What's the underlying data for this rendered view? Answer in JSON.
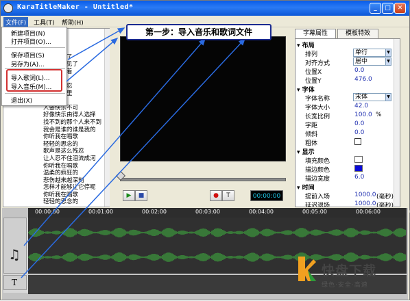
{
  "window": {
    "title": "KaraTitleMaker - Untitled*",
    "min": "_",
    "max": "□",
    "close": "✕"
  },
  "menu": {
    "file": "文件(F)",
    "tools": "工具(T)",
    "help": "帮助(H)"
  },
  "file_menu": {
    "new_project": "新建项目(N)",
    "open_project": "打开项目(O)...",
    "save_project": "保存项目(S)",
    "save_as": "另存为(A)...",
    "import_lyrics": "导入歌词(L)...",
    "import_music": "导入音乐(M)...",
    "exit": "退出(X)"
  },
  "callout": {
    "text": "第一步：导入音乐和歌词文件"
  },
  "lyrics": {
    "lines": [
      "惆怅着",
      "又开始爱了",
      "很久没再见了",
      "然也能笑着",
      "在唱歌",
      "是这么残忍",
      "在我泪眼里",
      "",
      "人要快乐不可",
      "好像快乐由得人选择",
      "找不到的那个人来不到",
      "我会是谁的谁是我的",
      "你听我在唱歌",
      "轻轻的思念的",
      "歌声是这么残忍",
      "让人忍不住泪流成河",
      "你听我在唱歌",
      "温柔的疯狂的",
      "悲伤越来越深刻",
      "怎样才能够让它停呢",
      "你听我在唱歌",
      "轻轻的思念的"
    ]
  },
  "player": {
    "play": "▶",
    "stop": "■",
    "record": "●",
    "text": "T",
    "timecode": "00:00:00"
  },
  "right_panel": {
    "tabs": {
      "subtitle": "字幕属性",
      "template": "模板特效"
    },
    "layout": {
      "section": "布局",
      "arrange_label": "排列",
      "arrange_value": "单行",
      "align_label": "对齐方式",
      "align_value": "居中",
      "pos_x_label": "位置X",
      "pos_x_value": "0.0",
      "pos_y_label": "位置Y",
      "pos_y_value": "476.0"
    },
    "font": {
      "section": "字体",
      "name_label": "字体名称",
      "name_value": "宋体",
      "size_label": "字体大小",
      "size_value": "42.0",
      "aspect_label": "长宽比例",
      "aspect_value": "100.0",
      "aspect_unit": "%",
      "spacing_label": "字距",
      "spacing_value": "0.0",
      "italic_label": "倾斜",
      "italic_value": "0.0",
      "bold_label": "粗体"
    },
    "display": {
      "section": "显示",
      "fill_label": "填充颜色",
      "fill_color": "#ffffff",
      "stroke_label": "描边颜色",
      "stroke_color": "#0a0ad8",
      "stroke_width_label": "描边宽度",
      "stroke_width_value": "6.0"
    },
    "time": {
      "section": "时间",
      "lead_in_label": "提前入场",
      "lead_in_value": "1000.0",
      "lead_in_unit": "(毫秒)",
      "lead_out_label": "延迟退场",
      "lead_out_value": "1000.0",
      "lead_out_unit": "(毫秒)"
    }
  },
  "timeline": {
    "ticks": [
      "00:00:00",
      "00:01:00",
      "00:02:00",
      "00:03:00",
      "00:04:00",
      "00:05:00",
      "00:06:00",
      "00:07"
    ],
    "music_track_icon": "music-note-icon",
    "text_track_label": "T"
  },
  "watermark": {
    "brand": "快盘下载",
    "slogan": "绿色·安全·高速"
  }
}
